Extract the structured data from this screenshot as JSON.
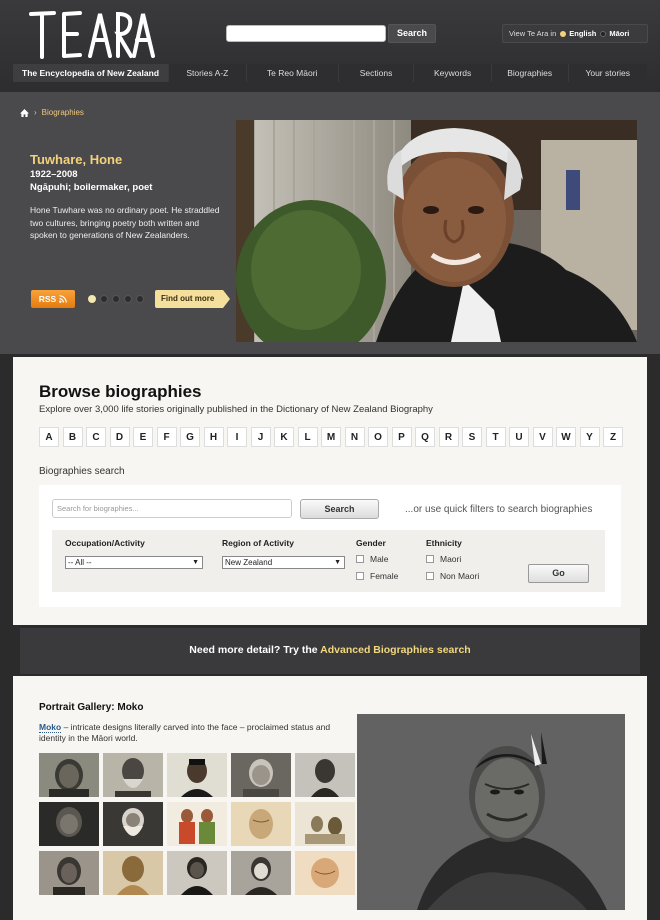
{
  "header": {
    "logo_text": "TE ARA",
    "tagline": "The Encyclopedia of New Zealand",
    "search_button": "Search",
    "view_label": "View Te Ara in",
    "lang_english": "English",
    "lang_maori": "Māori",
    "nav": [
      "Stories A-Z",
      "Te Reo Māori",
      "Sections",
      "Keywords",
      "Biographies",
      "Your stories"
    ]
  },
  "hero": {
    "breadcrumb": "Biographies",
    "title": "Tuwhare, Hone",
    "dates": "1922–2008",
    "subtitle": "Ngāpuhi; boilermaker, poet",
    "description": "Hone Tuwhare was no ordinary poet. He straddled two cultures, bringing poetry both written and spoken to generations of New Zealanders.",
    "rss_label": "RSS",
    "find_out_more": "Find out more",
    "slide_count": 5,
    "active_slide": 1
  },
  "browse": {
    "title": "Browse biographies",
    "subtitle": "Explore over 3,000 life stories originally published in the Dictionary of New Zealand Biography",
    "letters": [
      "A",
      "B",
      "C",
      "D",
      "E",
      "F",
      "G",
      "H",
      "I",
      "J",
      "K",
      "L",
      "M",
      "N",
      "O",
      "P",
      "Q",
      "R",
      "S",
      "T",
      "U",
      "V",
      "W",
      "Y",
      "Z"
    ],
    "search_label": "Biographies search",
    "search_placeholder": "Search for biographies...",
    "search_button": "Search",
    "quick_filter_text": "...or use quick filters to search biographies",
    "occupation_label": "Occupation/Activity",
    "occupation_value": "-- All --",
    "region_label": "Region of Activity",
    "region_value": "New Zealand",
    "gender_label": "Gender",
    "gender_male": "Male",
    "gender_female": "Female",
    "ethnicity_label": "Ethnicity",
    "ethnicity_maori": "Maori",
    "ethnicity_nonmaori": "Non Maori",
    "go_button": "Go"
  },
  "advanced": {
    "lead": "Need more detail? Try the ",
    "link": "Advanced Biographies search"
  },
  "gallery": {
    "title": "Portrait Gallery: Moko",
    "desc_link": "Moko",
    "desc_rest": " – intricate designs literally carved into the face – proclaimed status and identity in the Māori world."
  },
  "colors": {
    "accent_gold": "#f3d27a",
    "rss_orange": "#e47c10",
    "link_blue": "#2a5b8b"
  }
}
